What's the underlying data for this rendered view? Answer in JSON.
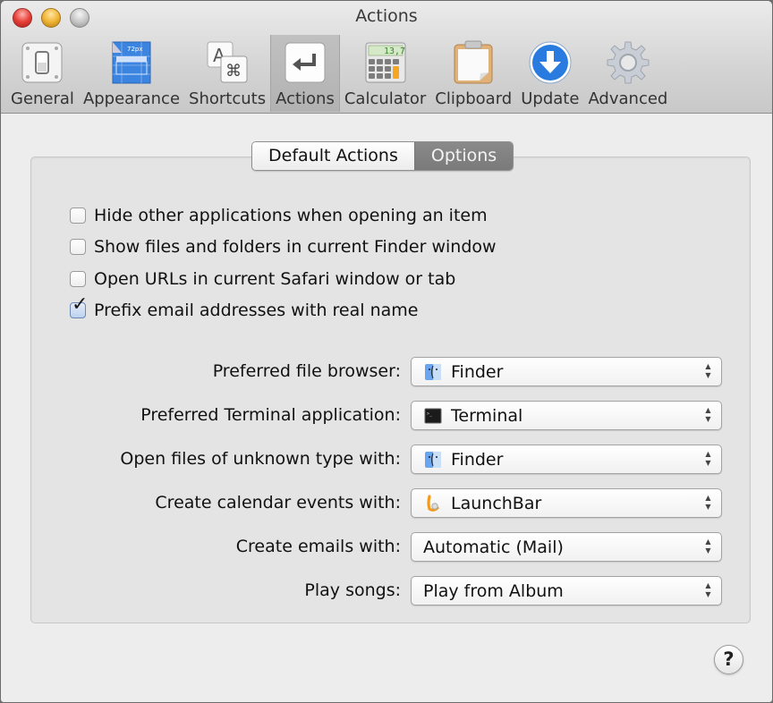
{
  "window": {
    "title": "Actions",
    "controls": [
      "close",
      "minimize",
      "zoom"
    ]
  },
  "toolbar": {
    "items": [
      {
        "label": "General",
        "icon": "switch-icon",
        "active": false
      },
      {
        "label": "Appearance",
        "icon": "appearance-icon",
        "active": false
      },
      {
        "label": "Shortcuts",
        "icon": "shortcuts-icon",
        "active": false
      },
      {
        "label": "Actions",
        "icon": "return-arrow-icon",
        "active": true
      },
      {
        "label": "Calculator",
        "icon": "calculator-icon",
        "active": false
      },
      {
        "label": "Clipboard",
        "icon": "clipboard-icon",
        "active": false
      },
      {
        "label": "Update",
        "icon": "download-arrow-icon",
        "active": false
      },
      {
        "label": "Advanced",
        "icon": "gear-icon",
        "active": false
      }
    ],
    "calculator_display": "13,7",
    "appearance_badge": "72px"
  },
  "tabs": {
    "items": [
      {
        "label": "Default Actions",
        "selected": false
      },
      {
        "label": "Options",
        "selected": true
      }
    ]
  },
  "options": {
    "checkboxes": [
      {
        "label": "Hide other applications when opening an item",
        "checked": false
      },
      {
        "label": "Show files and folders in current Finder window",
        "checked": false
      },
      {
        "label": "Open URLs in current Safari window or tab",
        "checked": false
      },
      {
        "label": "Prefix email addresses with real name",
        "checked": true
      }
    ],
    "popups": [
      {
        "label": "Preferred file browser:",
        "value": "Finder",
        "icon": "finder-icon"
      },
      {
        "label": "Preferred Terminal application:",
        "value": "Terminal",
        "icon": "terminal-icon"
      },
      {
        "label": "Open files of unknown type with:",
        "value": "Finder",
        "icon": "finder-icon"
      },
      {
        "label": "Create calendar events with:",
        "value": "LaunchBar",
        "icon": "launchbar-icon"
      },
      {
        "label": "Create emails with:",
        "value": "Automatic (Mail)",
        "icon": null
      },
      {
        "label": "Play songs:",
        "value": "Play from Album",
        "icon": null
      }
    ]
  },
  "help": {
    "label": "?"
  },
  "colors": {
    "selected_tab_bg": "#808080",
    "checkbox_checked": "#bcd1ee",
    "close": "#e73f37",
    "minimize": "#f0b534",
    "update_blue": "#2a7be0"
  }
}
